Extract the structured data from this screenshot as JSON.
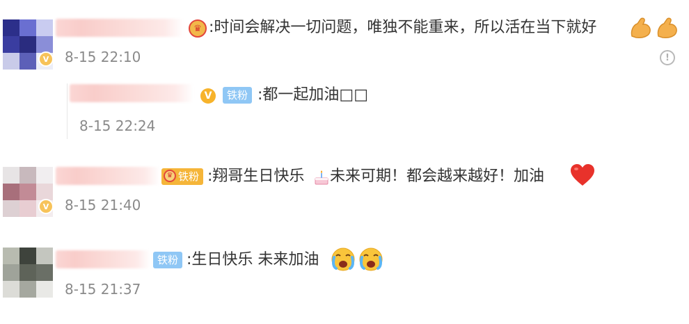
{
  "comments": [
    {
      "text": ":时间会解决一切问题，唯独不能重来，所以活在当下就好",
      "time": "8-15 22:10",
      "trailing_emoji": [
        "flexed-biceps",
        "flexed-biceps"
      ],
      "badge_label": "",
      "has_report_icon": true
    },
    {
      "badge_label": "铁粉",
      "text": ":都一起加油□□",
      "time": "8-15 22:24",
      "is_reply": true
    },
    {
      "badge_label": "铁粉",
      "text_a": ":翔哥生日快乐",
      "text_b": " 未来可期！都会越来越好！加油",
      "time": "8-15 21:40",
      "emoji": [
        "birthday-cake",
        "red-heart"
      ]
    },
    {
      "badge_label": "铁粉",
      "text": ":生日快乐 未来加油",
      "time": "8-15 21:37",
      "emoji": [
        "crying-face",
        "crying-face"
      ]
    }
  ],
  "report_glyph": "!",
  "verified_glyph": "V",
  "medal_glyph": "♛",
  "avatar_badge_glyph": "V",
  "colors": {
    "text": "#333333",
    "time": "#8a8a8a",
    "fan_badge_blue": "#8fc7f5",
    "fan_badge_gold": "#f5b539",
    "name_blur": "#fbd6d4"
  }
}
